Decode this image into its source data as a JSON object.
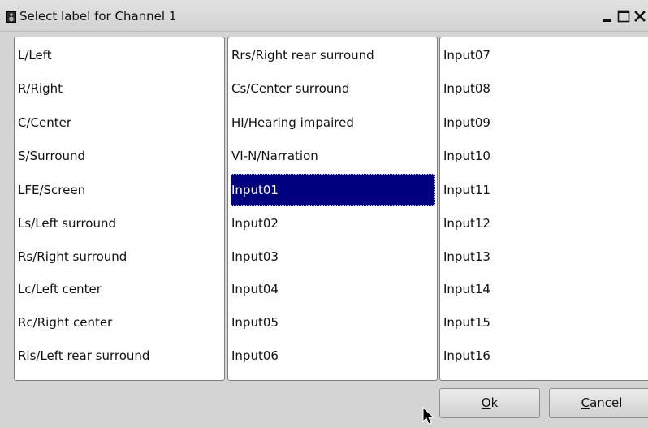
{
  "window": {
    "title": "Select label for Channel 1"
  },
  "icons": {
    "app": "speaker-icon",
    "minimize": "minimize-icon",
    "maximize": "maximize-icon",
    "close": "close-icon",
    "cursor": "mouse-pointer-icon"
  },
  "columns": [
    {
      "items": [
        "L/Left",
        "R/Right",
        "C/Center",
        "S/Surround",
        "LFE/Screen",
        "Ls/Left surround",
        "Rs/Right surround",
        "Lc/Left center",
        "Rc/Right center",
        "Rls/Left rear surround"
      ]
    },
    {
      "items": [
        "Rrs/Right rear surround",
        "Cs/Center surround",
        "HI/Hearing impaired",
        "VI-N/Narration",
        "Input01",
        "Input02",
        "Input03",
        "Input04",
        "Input05",
        "Input06"
      ]
    },
    {
      "items": [
        "Input07",
        "Input08",
        "Input09",
        "Input10",
        "Input11",
        "Input12",
        "Input13",
        "Input14",
        "Input15",
        "Input16"
      ]
    }
  ],
  "selected": "Input01",
  "buttons": {
    "ok": {
      "mnemonic": "O",
      "rest": "k"
    },
    "cancel": {
      "mnemonic": "C",
      "rest": "ancel"
    }
  },
  "colors": {
    "selection_bg": "#00007f",
    "selection_fg": "#ffffff"
  }
}
